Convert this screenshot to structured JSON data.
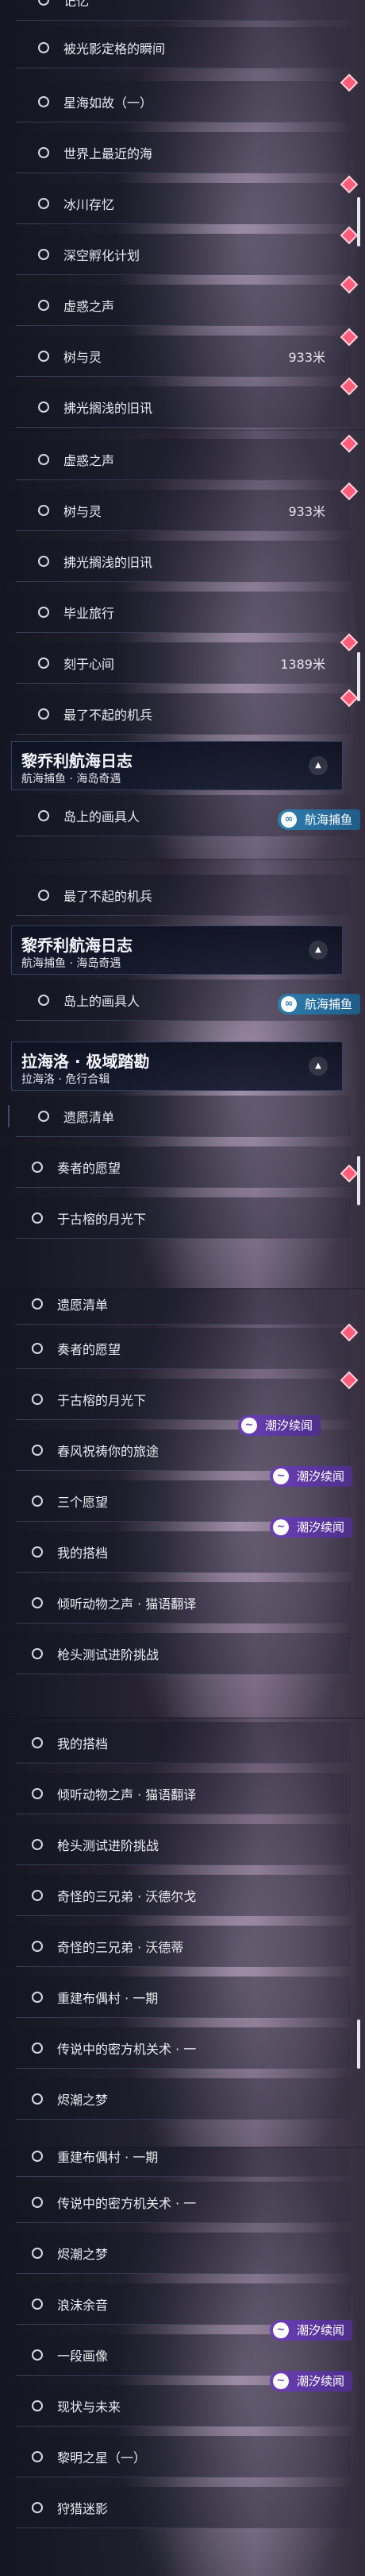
{
  "quests": {
    "hanghai": {
      "title": "黎乔利航海日志",
      "subtitle": "航海捕鱼 · 海岛奇遇"
    },
    "lahailuo": {
      "title": "拉海洛 · 极域踏勘",
      "subtitle": "拉海洛 · 危行合辑"
    }
  },
  "tags": {
    "chaoxi": "潮汐续闻",
    "hanghai": "航海捕鱼"
  },
  "icons": {
    "diamond": "diamond-marker-icon",
    "dot": "circle-bullet-icon",
    "tag_chaoxi": "wave-icon",
    "tag_hanghai": "fish-icon"
  },
  "colors": {
    "tag_purple": "#6c3fb8",
    "tag_blue": "#2d7fb0",
    "marker": "#ff5c7a"
  },
  "p1": {
    "i0": "记忆",
    "i1": "被光影定格的瞬间",
    "i2": "星海如故（一）",
    "i3": "世界上最近的海",
    "i4": "冰川存忆",
    "i5": "深空孵化计划",
    "i6": "虚惑之声",
    "i7": "树与灵",
    "i7d": "933米",
    "i8": "拂光搁浅的旧讯"
  },
  "p2": {
    "i0": "虚惑之声",
    "i1": "树与灵",
    "i1d": "933米",
    "i2": "拂光搁浅的旧讯",
    "i3": "毕业旅行",
    "i4": "刻于心间",
    "i4d": "1389米",
    "i5": "最了不起的机兵",
    "i6": "岛上的画具人"
  },
  "p3": {
    "i0": "最了不起的机兵",
    "i1": "岛上的画具人",
    "i2": "遗愿清单",
    "i3": "奏者的愿望",
    "i4": "于古榕的月光下"
  },
  "p4": {
    "i0": "遗愿清单",
    "i1": "奏者的愿望",
    "i2": "于古榕的月光下",
    "i3": "春风祝祷你的旅途",
    "i4": "三个愿望",
    "i5": "我的搭档",
    "i6": "倾听动物之声 · 猫语翻译",
    "i7": "枪头测试进阶挑战"
  },
  "p5": {
    "i0": "我的搭档",
    "i1": "倾听动物之声 · 猫语翻译",
    "i2": "枪头测试进阶挑战",
    "i3": "奇怪的三兄弟 · 沃德尔戈",
    "i4": "奇怪的三兄弟 · 沃德蒂",
    "i5": "重建布偶村 · 一期",
    "i6": "传说中的密方机关术 · 一",
    "i7": "烬潮之梦"
  },
  "p6": {
    "i0": "重建布偶村 · 一期",
    "i1": "传说中的密方机关术 · 一",
    "i2": "烬潮之梦",
    "i3": "浪沫余音",
    "i4": "一段画像",
    "i5": "现状与未来",
    "i6": "黎明之星（一）",
    "i7": "狩猎迷影"
  }
}
